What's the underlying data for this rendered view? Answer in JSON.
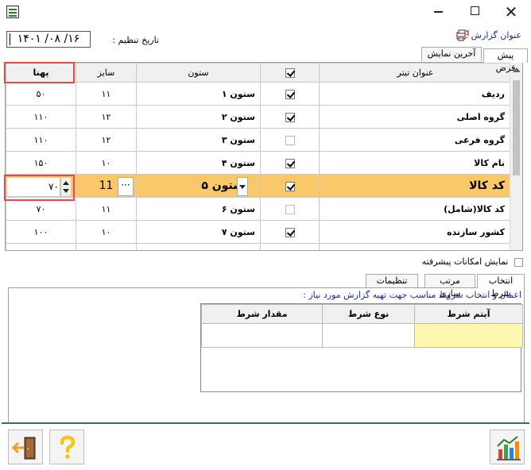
{
  "window": {
    "minimize": "",
    "maximize": "",
    "close": "✕"
  },
  "header": {
    "report_title_label": "عنوان گزارش :",
    "last_settings_date_label": "تاریخ تنظیم :",
    "date_value": "۱۴۰۱ /۰۸ /۱۶"
  },
  "top_tabs": [
    "پیش فرض",
    "آخرین نمایش"
  ],
  "grid": {
    "columns": {
      "title": "عنوان تیتر",
      "visible": "",
      "column": "ستون",
      "size": "سایز",
      "width": "پهنا"
    },
    "header_checkbox_checked": true,
    "rows": [
      {
        "title": "ردیف",
        "checked": true,
        "column": "ستون ۱",
        "size": "۱۱",
        "width": "۵۰"
      },
      {
        "title": "گروه اصلی",
        "checked": true,
        "column": "ستون ۲",
        "size": "۱۲",
        "width": "۱۱۰"
      },
      {
        "title": "گروه فرعی",
        "checked": false,
        "column": "ستون ۳",
        "size": "۱۲",
        "width": "۱۱۰"
      },
      {
        "title": "نام کالا",
        "checked": true,
        "column": "ستون ۴",
        "size": "۱۰",
        "width": "۱۵۰"
      },
      {
        "title": "کد کالا",
        "checked": true,
        "column": "ستون ۵",
        "size": "11",
        "width": "۷۰"
      },
      {
        "title": "کد کالا(شامل)",
        "checked": false,
        "column": "ستون ۶",
        "size": "۱۱",
        "width": "۷۰"
      },
      {
        "title": "کشور سازنده",
        "checked": true,
        "column": "ستون ۷",
        "size": "۱۰",
        "width": "۱۰۰"
      }
    ],
    "selected_row": 4,
    "editing_width_value": "۷۰"
  },
  "advanced": {
    "label": "نمایش امکانات پیشرفته",
    "checked": false
  },
  "bottom_tabs": [
    "انتخاب شرط",
    "مرتب سازی",
    "تنظیمات"
  ],
  "conditions": {
    "description": "اعمال و انتخاب شروط مناسب جهت تهیه گزارش  مورد نیاز :",
    "columns": [
      "آیتم شرط",
      "نوع شرط",
      "مقدار شرط"
    ]
  },
  "colors": {
    "selected_row": "#f9c86a",
    "highlight_box": "#e8474c",
    "accent_text": "#1d2f8f",
    "footer_line": "#2b6e7e",
    "condition_cell": "#fdf7b0"
  },
  "icons": {
    "exit": "exit-door-icon",
    "help": "question-mark-icon",
    "report": "bar-chart-icon"
  }
}
